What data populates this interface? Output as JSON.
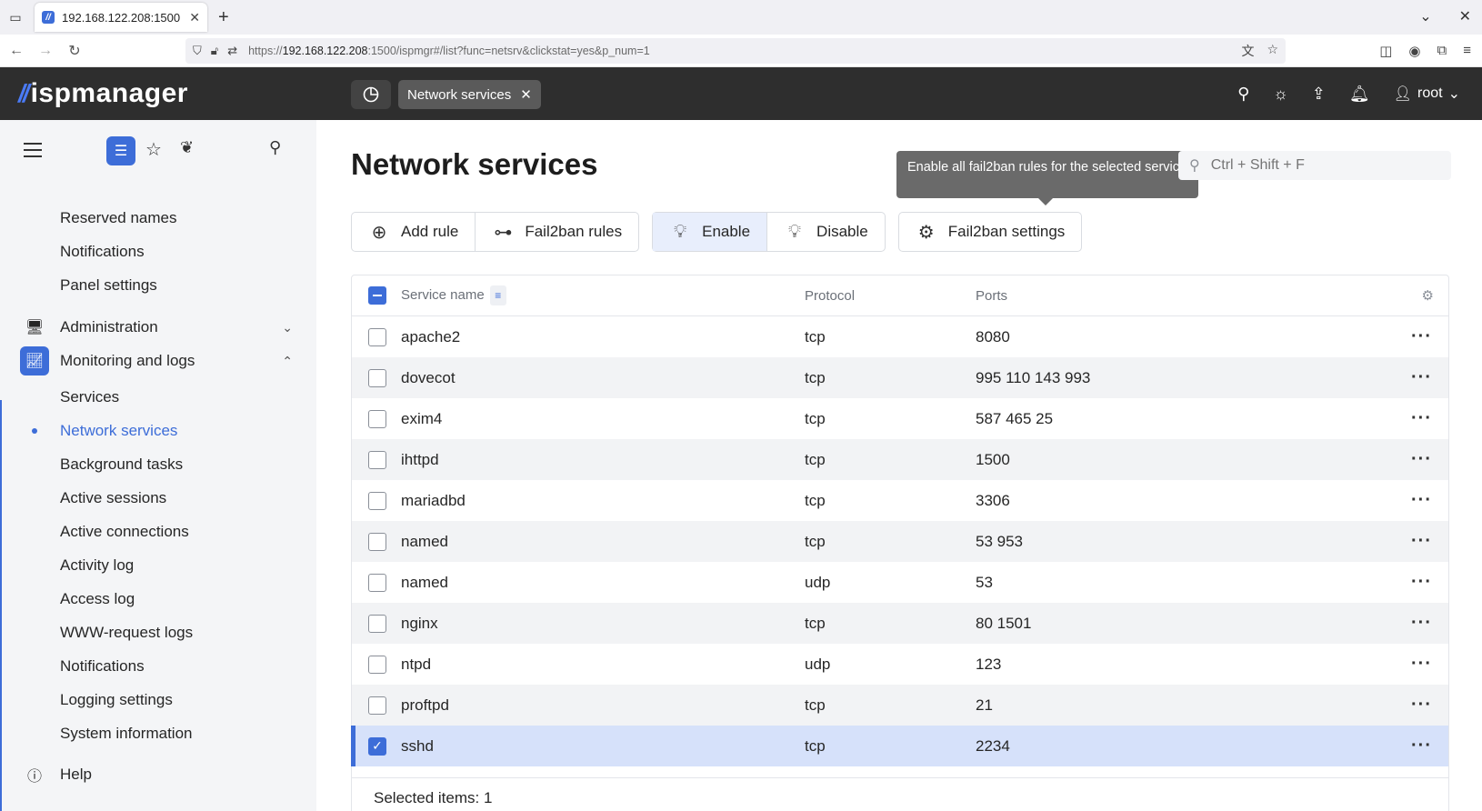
{
  "browser": {
    "tab_title": "192.168.122.208:1500",
    "url_prefix": "https://",
    "url_host": "192.168.122.208",
    "url_path": ":1500/ispmgr#/list?func=netsrv&clickstat=yes&p_num=1"
  },
  "header": {
    "logo": "ispmanager",
    "page_chip": "Network services",
    "user": "root"
  },
  "sidebar": {
    "items_top": [
      "Reserved names",
      "Notifications",
      "Panel settings"
    ],
    "sections": [
      {
        "label": "Administration",
        "icon": "monitor-icon",
        "expanded": false
      },
      {
        "label": "Monitoring and logs",
        "icon": "chart-icon",
        "expanded": true
      }
    ],
    "monitoring_items": [
      "Services",
      "Network services",
      "Background tasks",
      "Active sessions",
      "Active connections",
      "Activity log",
      "Access log",
      "WWW-request logs",
      "Notifications",
      "Logging settings",
      "System information"
    ],
    "active_item": "Network services",
    "help": "Help"
  },
  "main": {
    "title": "Network services",
    "tooltip": "Enable all fail2ban rules for the selected service",
    "search_placeholder": "Ctrl + Shift + F",
    "toolbar": {
      "add_rule": "Add rule",
      "fail2ban_rules": "Fail2ban rules",
      "enable": "Enable",
      "disable": "Disable",
      "fail2ban_settings": "Fail2ban settings"
    },
    "table": {
      "columns": [
        "Service name",
        "Protocol",
        "Ports"
      ],
      "rows": [
        {
          "name": "apache2",
          "protocol": "tcp",
          "ports": "8080",
          "selected": false
        },
        {
          "name": "dovecot",
          "protocol": "tcp",
          "ports": "995 110 143 993",
          "selected": false
        },
        {
          "name": "exim4",
          "protocol": "tcp",
          "ports": "587 465 25",
          "selected": false
        },
        {
          "name": "ihttpd",
          "protocol": "tcp",
          "ports": "1500",
          "selected": false
        },
        {
          "name": "mariadbd",
          "protocol": "tcp",
          "ports": "3306",
          "selected": false
        },
        {
          "name": "named",
          "protocol": "tcp",
          "ports": "53 953",
          "selected": false
        },
        {
          "name": "named",
          "protocol": "udp",
          "ports": "53",
          "selected": false
        },
        {
          "name": "nginx",
          "protocol": "tcp",
          "ports": "80 1501",
          "selected": false
        },
        {
          "name": "ntpd",
          "protocol": "udp",
          "ports": "123",
          "selected": false
        },
        {
          "name": "proftpd",
          "protocol": "tcp",
          "ports": "21",
          "selected": false
        },
        {
          "name": "sshd",
          "protocol": "tcp",
          "ports": "2234",
          "selected": true
        }
      ]
    },
    "footer": "Selected items: 1"
  },
  "colors": {
    "accent": "#3d6dd8",
    "header_bg": "#2e2e2e",
    "sidebar_bg": "#f4f5f7"
  }
}
